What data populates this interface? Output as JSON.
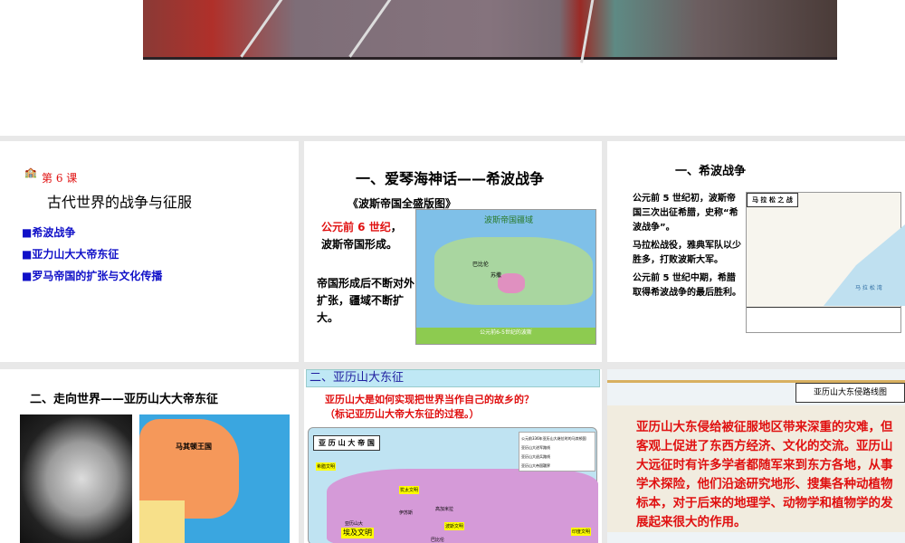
{
  "slides": [
    {
      "lesson": "第 6 课",
      "title": "古代世界的战争与征服",
      "bullets": [
        "希波战争",
        "亚力山大大帝东征",
        "罗马帝国的扩张与文化传播"
      ]
    },
    {
      "title": "一、爱琴海神话——希波战争",
      "caption": "《波斯帝国全盛版图》",
      "red_text": "公元前 6 世纪",
      "text1": "，波斯帝国形成。",
      "text2": "帝国形成后不断对外扩张，疆域不断扩大。",
      "map_title": "波斯帝国疆域",
      "map_footer": "公元前6-5世纪的波斯",
      "map_labels": [
        "巴比伦",
        "苏撒"
      ]
    },
    {
      "title": "一、希波战争",
      "p1": "公元前 5 世纪初，波斯帝国三次出征希腊，史称“希波战争”。",
      "p2": "马拉松战役，雅典军队以少胜多，打败波斯大军。",
      "p3": "公元前 5 世纪中期，希腊取得希波战争的最后胜利。",
      "map_title": "马 拉 松 之 战",
      "map_sea": "马 拉 松 湾"
    },
    {
      "title": "二、走向世界——亚历山大大帝东征",
      "map_label": "马其顿王国"
    },
    {
      "header": "二、亚历山大东征",
      "question": "亚历山大是如何实现把世界当作自己的故乡的？",
      "hint": "（标记亚历山大帝大东征的过程。）",
      "map_title": "亚 历 山 大 帝 国",
      "tags": [
        "希腊文明",
        "犹太文明",
        "波斯文明",
        "埃及文明",
        "印度文明"
      ],
      "places": [
        "高加米拉",
        "巴比伦",
        "亚历山大",
        "伊苏斯"
      ],
      "legend": [
        "公元前336年亚历山大继位时的马其顿国",
        "亚历山大进军路线",
        "亚历山大退兵路线",
        "亚历山大帝国疆界"
      ]
    },
    {
      "map_title": "亚历山大东侵路线图",
      "text": "亚历山大东侵给被征服地区带来深重的灾难，但客观上促进了东西方经济、文化的交流。亚历山大远征时有许多学者都随军来到东方各地，从事学术探险，他们沿途研究地形、搜集各种动植物标本，对于后来的地理学、动物学和植物学的发展起来很大的作用。"
    }
  ]
}
